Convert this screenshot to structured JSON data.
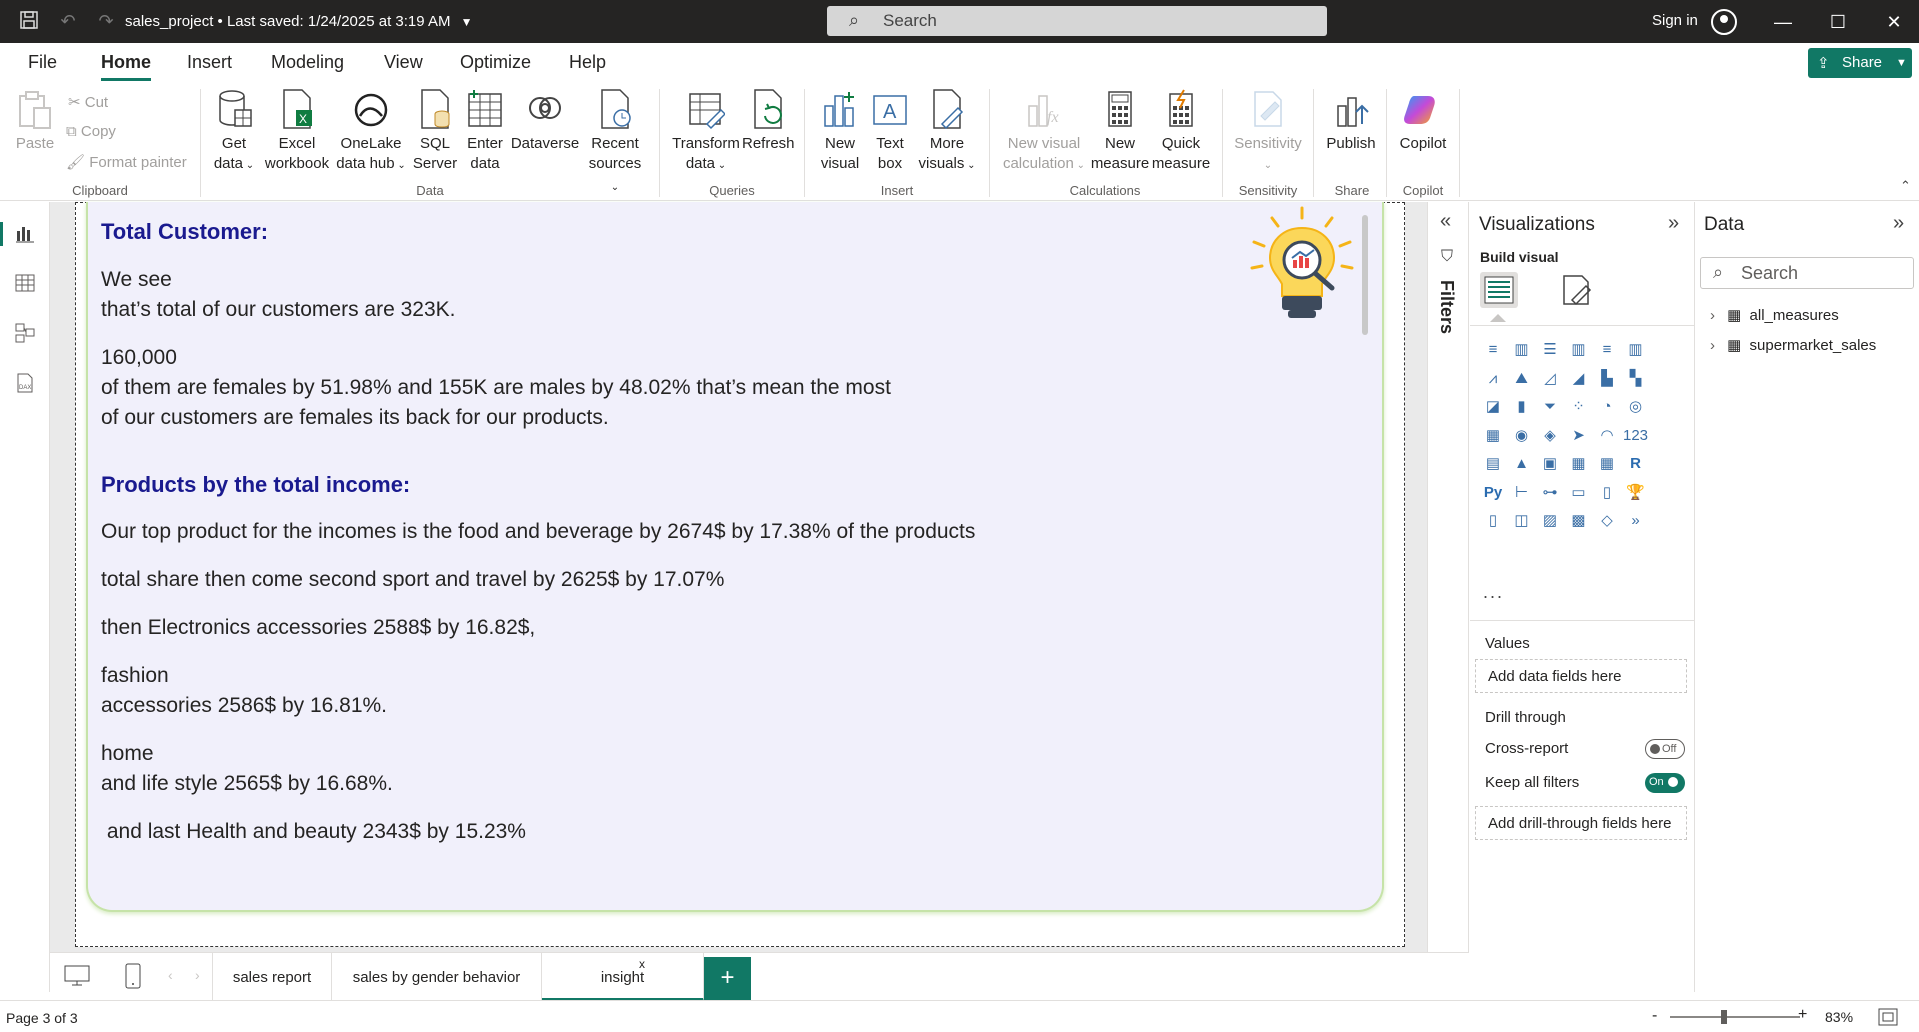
{
  "titlebar": {
    "title": "sales_project • Last saved: 1/24/2025 at 3:19 AM",
    "search_placeholder": "Search",
    "signin": "Sign in"
  },
  "menu": {
    "tabs": [
      "File",
      "Home",
      "Insert",
      "Modeling",
      "View",
      "Optimize",
      "Help"
    ],
    "active": "Home",
    "share_label": "Share"
  },
  "ribbon": {
    "clipboard": {
      "paste": "Paste",
      "cut": "Cut",
      "copy": "Copy",
      "format_painter": "Format painter",
      "group": "Clipboard"
    },
    "data": {
      "get_data": [
        "Get",
        "data"
      ],
      "excel": [
        "Excel",
        "workbook"
      ],
      "onelake": [
        "OneLake",
        "data hub"
      ],
      "sql": [
        "SQL",
        "Server"
      ],
      "enter": [
        "Enter",
        "data"
      ],
      "dataverse": [
        "Dataverse",
        ""
      ],
      "recent": [
        "Recent",
        "sources"
      ],
      "group": "Data"
    },
    "queries": {
      "transform": [
        "Transform",
        "data"
      ],
      "refresh": [
        "Refresh",
        ""
      ],
      "group": "Queries"
    },
    "insert": {
      "new_visual": [
        "New",
        "visual"
      ],
      "text_box": [
        "Text",
        "box"
      ],
      "more_visuals": [
        "More",
        "visuals"
      ],
      "group": "Insert"
    },
    "calculations": {
      "new_visual_calc": [
        "New visual",
        "calculation"
      ],
      "new_measure": [
        "New",
        "measure"
      ],
      "quick_measure": [
        "Quick",
        "measure"
      ],
      "group": "Calculations"
    },
    "sensitivity": {
      "label": "Sensitivity",
      "group": "Sensitivity"
    },
    "share": {
      "publish": "Publish",
      "group": "Share"
    },
    "copilot": {
      "label": "Copilot",
      "group": "Copilot"
    }
  },
  "insight": {
    "heading1": "Total Customer:",
    "lines1": [
      "We see",
      "that’s total of our customers are 323K.",
      "160,000",
      "of them are females by 51.98% and 155K are males by 48.02% that’s mean the most",
      "of our customers are females its back for our products."
    ],
    "heading2": "Products by the total income:",
    "lines2": [
      "Our top product for the incomes is the food and beverage by 2674$ by 17.38% of the products",
      "total share then come second sport and travel by 2625$ by 17.07%",
      "then Electronics accessories 2588$ by 16.82$,",
      "fashion",
      "accessories 2586$ by 16.81%.",
      "home",
      "and life style 2565$ by 16.68%.",
      " and last Health and beauty 2343$ by 15.23%"
    ]
  },
  "filters": {
    "label": "Filters"
  },
  "visualizations": {
    "title": "Visualizations",
    "build_visual": "Build visual",
    "values_label": "Values",
    "values_placeholder": "Add data fields here",
    "drill_through": "Drill through",
    "cross_report": "Cross-report",
    "cross_report_state": "Off",
    "keep_all_filters": "Keep all filters",
    "keep_all_filters_state": "On",
    "drill_placeholder": "Add drill-through fields here",
    "more": "..."
  },
  "data_pane": {
    "title": "Data",
    "search_placeholder": "Search",
    "tables": [
      "all_measures",
      "supermarket_sales"
    ]
  },
  "pages": {
    "tabs": [
      "sales report",
      "sales by gender behavior",
      "insight"
    ],
    "active": "insight",
    "close": "x",
    "add": "+"
  },
  "status": {
    "page_info": "Page 3 of 3",
    "zoom": "83%",
    "zoom_level": 0.83
  },
  "colors": {
    "accent": "#117865",
    "heading": "#1a1a8f",
    "card_bg": "#f1f0fb",
    "card_border": "#c6e3a8"
  }
}
